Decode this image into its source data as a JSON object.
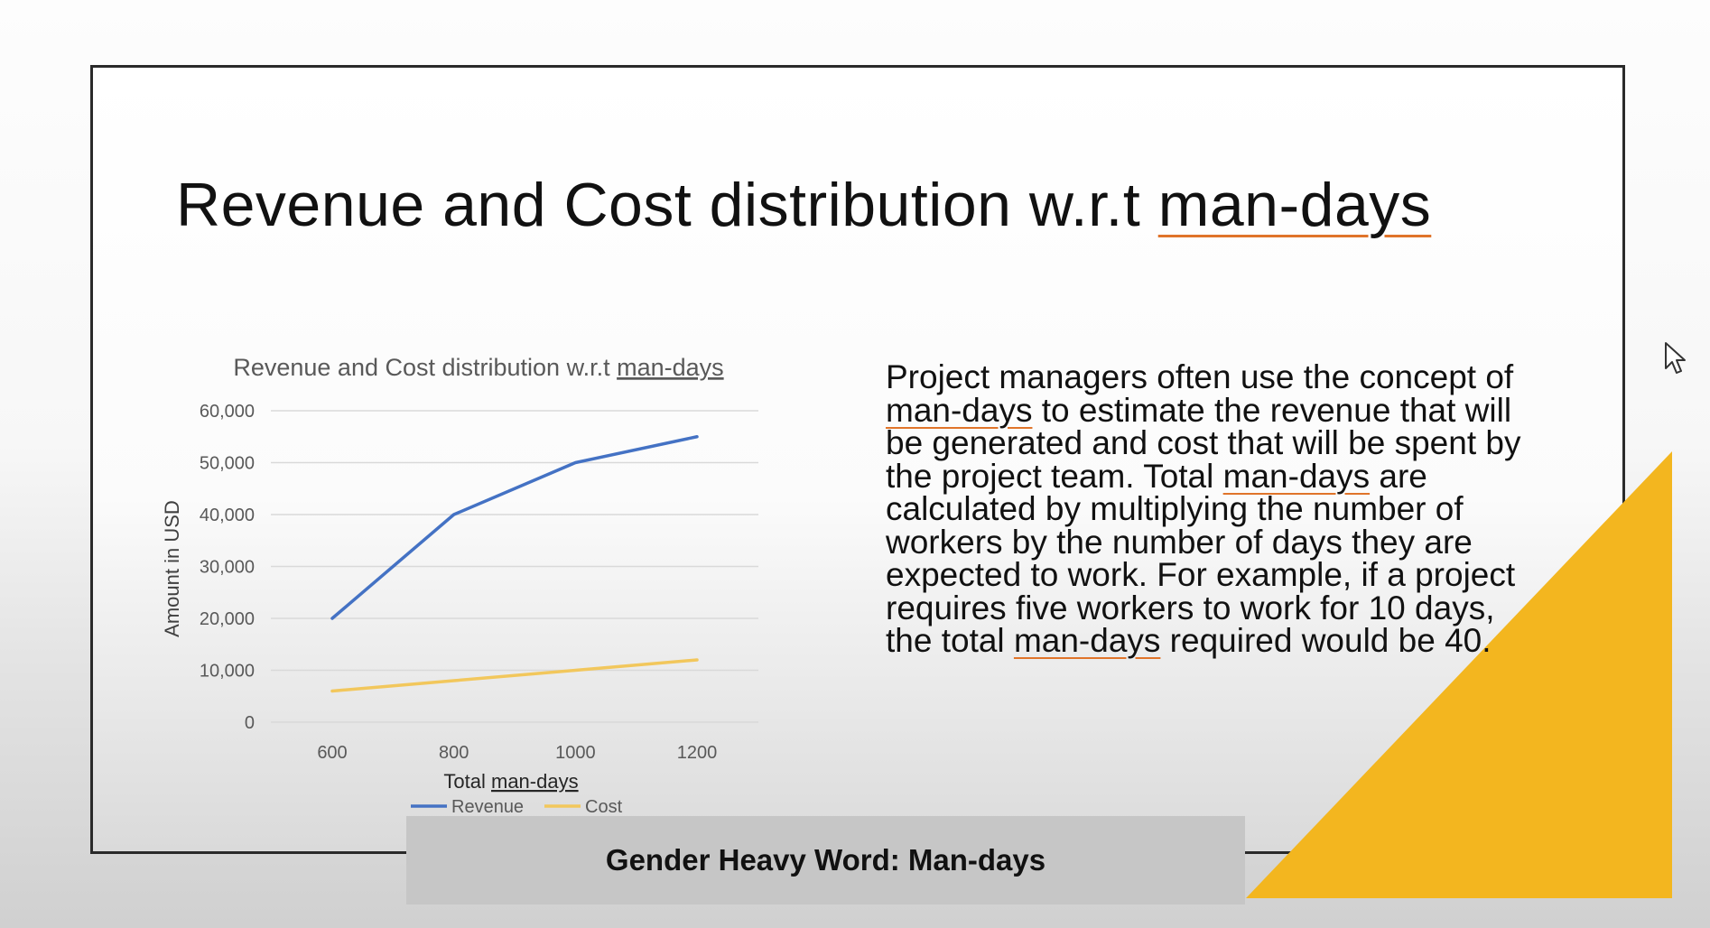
{
  "slide": {
    "title_prefix": "Revenue and Cost distribution w.r.t ",
    "title_emphasis": "man-days",
    "body": {
      "p1": "Project managers often use the concept of ",
      "p2": "man-days",
      "p3": " to estimate the revenue that will be generated and cost that will be spent by the project team. Total ",
      "p4": "man-days",
      "p5": " are calculated by multiplying the number of workers by the number of days they are expected to work. For example, if a project requires five workers to work for 10 days, the total ",
      "p6": "man-days",
      "p7": " required would be 40."
    },
    "caption": "Gender Heavy Word: Man-days",
    "accent_color": "#f3b61f"
  },
  "chart_data": {
    "type": "line",
    "title_prefix": "Revenue and Cost distribution w.r.t ",
    "title_emphasis": "man-days",
    "x": [
      600,
      800,
      1000,
      1200
    ],
    "x_tick_labels": [
      "600",
      "800",
      "1000",
      "1200"
    ],
    "xlabel_prefix": "Total ",
    "xlabel_emphasis": "man-days",
    "ylabel": "Amount in USD",
    "ylim": [
      0,
      60000
    ],
    "y_ticks": [
      0,
      10000,
      20000,
      30000,
      40000,
      50000,
      60000
    ],
    "y_tick_labels": [
      "0",
      "10,000",
      "20,000",
      "30,000",
      "40,000",
      "50,000",
      "60,000"
    ],
    "grid": true,
    "legend_position": "bottom",
    "series": [
      {
        "name": "Revenue",
        "color": "#4472c4",
        "values": [
          20000,
          40000,
          50000,
          55000
        ]
      },
      {
        "name": "Cost",
        "color": "#f2c75c",
        "values": [
          6000,
          8000,
          10000,
          12000
        ]
      }
    ]
  },
  "cursor": {
    "icon": "mouse-pointer-icon"
  }
}
